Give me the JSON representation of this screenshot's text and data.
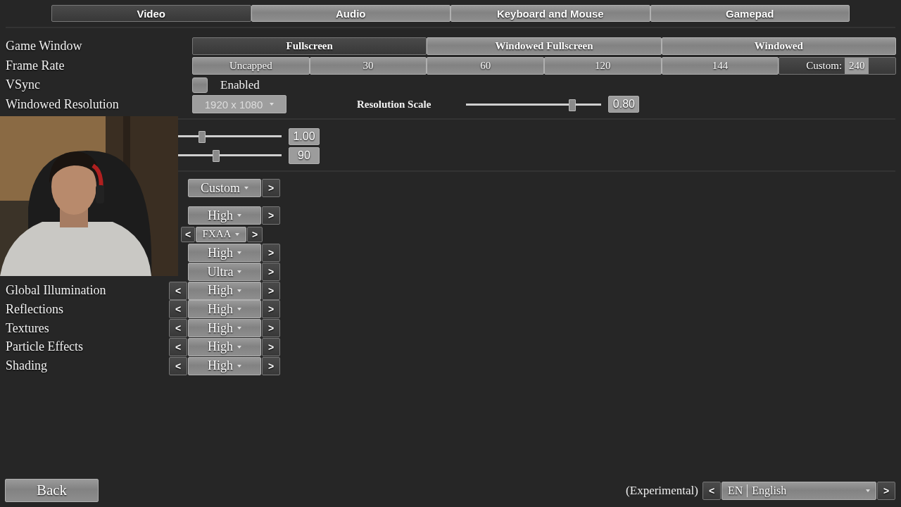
{
  "tabs": [
    {
      "label": "Video",
      "selected": true
    },
    {
      "label": "Audio",
      "selected": false
    },
    {
      "label": "Keyboard and Mouse",
      "selected": false
    },
    {
      "label": "Gamepad",
      "selected": false
    }
  ],
  "sections": [
    {
      "rows": [
        {
          "kind": "segmented",
          "label": "Game Window",
          "options": [
            {
              "label": "Fullscreen",
              "selected": true
            },
            {
              "label": "Windowed Fullscreen",
              "selected": false
            },
            {
              "label": "Windowed",
              "selected": false
            }
          ]
        },
        {
          "kind": "segmented",
          "label": "Frame Rate",
          "options": [
            {
              "label": "Uncapped",
              "selected": false
            },
            {
              "label": "30",
              "selected": false
            },
            {
              "label": "60",
              "selected": false
            },
            {
              "label": "120",
              "selected": false
            },
            {
              "label": "144",
              "selected": false
            },
            {
              "label": "Custom:",
              "value": "240",
              "selected": true
            }
          ]
        },
        {
          "kind": "checkbox",
          "label": "VSync",
          "text": "Enabled",
          "checked": false
        },
        {
          "kind": "resolution",
          "label": "Windowed Resolution",
          "dropdown": {
            "value": "1920 x 1080",
            "disabled": true
          },
          "scale": {
            "label": "Resolution Scale",
            "level": 0.78,
            "reading": "0.80"
          }
        }
      ]
    },
    {
      "rows": [
        {
          "kind": "slider",
          "level": 0.56,
          "reading": "1.00"
        },
        {
          "kind": "slider",
          "level": 0.64,
          "reading": "90"
        }
      ]
    },
    {
      "rows": [
        {
          "kind": "select",
          "value": "Custom",
          "next": ">"
        },
        {
          "kind": "select",
          "value": "High",
          "next": ">"
        },
        {
          "kind": "small-select",
          "prev": "<",
          "value": "FXAA",
          "next": ">"
        },
        {
          "kind": "select",
          "value": "High",
          "next": ">"
        },
        {
          "kind": "select",
          "value": "Ultra",
          "next": ">"
        },
        {
          "kind": "select",
          "label": "Global Illumination",
          "prev": "<",
          "value": "High",
          "next": ">"
        },
        {
          "kind": "select",
          "label": "Reflections",
          "prev": "<",
          "value": "High",
          "next": ">"
        },
        {
          "kind": "select",
          "label": "Textures",
          "prev": "<",
          "value": "High",
          "next": ">"
        },
        {
          "kind": "select",
          "label": "Particle Effects",
          "prev": "<",
          "value": "High",
          "next": ">"
        },
        {
          "kind": "select",
          "label": "Shading",
          "prev": "<",
          "value": "High",
          "next": ">"
        }
      ]
    }
  ],
  "footer": {
    "back": "Back",
    "language": {
      "note": "(Experimental)",
      "prev": "<",
      "code": "EN",
      "name": "English",
      "next": ">"
    }
  }
}
